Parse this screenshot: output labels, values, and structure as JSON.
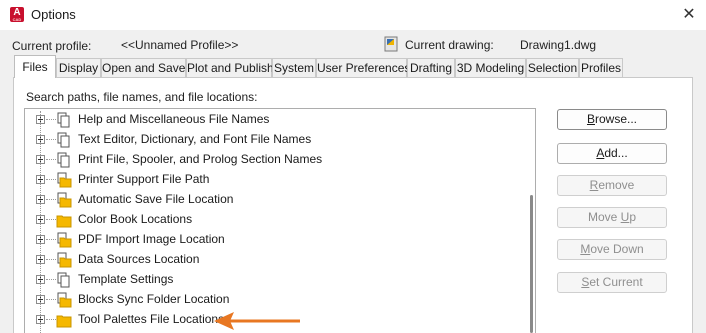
{
  "window": {
    "title": "Options",
    "close_glyph": "✕",
    "app_icon_letter": "A",
    "app_icon_sub": "CAD"
  },
  "profile": {
    "current_profile_label": "Current profile:",
    "current_profile_value": "<<Unnamed Profile>>",
    "current_drawing_label": "Current drawing:",
    "current_drawing_value": "Drawing1.dwg"
  },
  "tabs": [
    {
      "label": "Files",
      "active": true
    },
    {
      "label": "Display"
    },
    {
      "label": "Open and Save"
    },
    {
      "label": "Plot and Publish"
    },
    {
      "label": "System"
    },
    {
      "label": "User Preferences"
    },
    {
      "label": "Drafting"
    },
    {
      "label": "3D Modeling"
    },
    {
      "label": "Selection"
    },
    {
      "label": "Profiles"
    }
  ],
  "files_panel": {
    "heading": "Search paths, file names, and file locations:",
    "tree_items": [
      {
        "label": "Help and Miscellaneous File Names",
        "icon": "pages-icon"
      },
      {
        "label": "Text Editor, Dictionary, and Font File Names",
        "icon": "pages-icon"
      },
      {
        "label": "Print File, Spooler, and Prolog Section Names",
        "icon": "pages-icon"
      },
      {
        "label": "Printer Support File Path",
        "icon": "folder-stack-icon"
      },
      {
        "label": "Automatic Save File Location",
        "icon": "folder-stack-icon"
      },
      {
        "label": "Color Book Locations",
        "icon": "folder-icon"
      },
      {
        "label": "PDF Import Image Location",
        "icon": "folder-stack-icon"
      },
      {
        "label": "Data Sources Location",
        "icon": "folder-stack-icon"
      },
      {
        "label": "Template Settings",
        "icon": "pages-icon"
      },
      {
        "label": "Blocks Sync Folder Location",
        "icon": "folder-stack-icon"
      },
      {
        "label": "Tool Palettes File Locations",
        "icon": "folder-icon"
      }
    ]
  },
  "buttons": {
    "browse": {
      "pre": "",
      "u": "B",
      "post": "rowse...",
      "enabled": true
    },
    "add": {
      "pre": "",
      "u": "A",
      "post": "dd...",
      "enabled": true
    },
    "remove": {
      "pre": "",
      "u": "R",
      "post": "emove",
      "enabled": false
    },
    "move_up": {
      "pre": "Move ",
      "u": "U",
      "post": "p",
      "enabled": false
    },
    "move_down": {
      "pre": "",
      "u": "M",
      "post": "ove Down",
      "enabled": false
    },
    "set_current": {
      "pre": "",
      "u": "S",
      "post": "et Current",
      "enabled": false
    }
  },
  "colors": {
    "accent_arrow": "#e87722",
    "app_icon": "#c8102e",
    "folder": "#f5b800"
  }
}
